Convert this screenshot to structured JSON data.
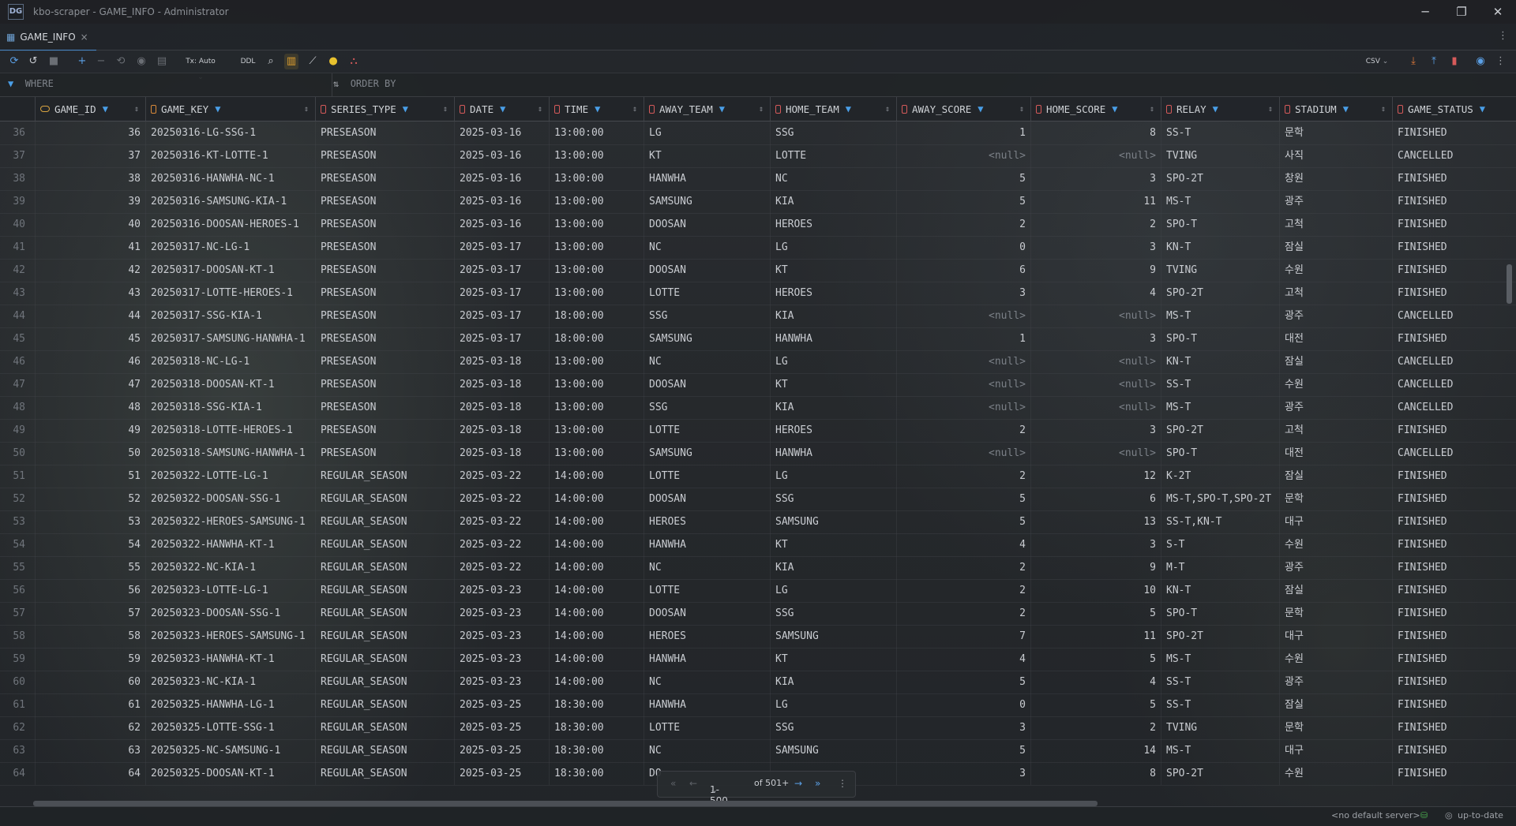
{
  "window": {
    "title": "kbo-scraper - GAME_INFO - Administrator",
    "controls": [
      "─",
      "❐",
      "✕"
    ]
  },
  "tab": {
    "label": "GAME_INFO",
    "close": "×"
  },
  "toolbar": {
    "tx_label": "Tx: Auto",
    "ddl_label": "DDL",
    "export_format": "CSV"
  },
  "filter": {
    "where_label": "WHERE",
    "orderby_label": "ORDER BY"
  },
  "columns": [
    {
      "label": "GAME_ID",
      "icon": "key-icon"
    },
    {
      "label": "GAME_KEY",
      "icon": "index-icon"
    },
    {
      "label": "SERIES_TYPE",
      "icon": "column-icon"
    },
    {
      "label": "DATE",
      "icon": "column-icon"
    },
    {
      "label": "TIME",
      "icon": "column-icon"
    },
    {
      "label": "AWAY_TEAM",
      "icon": "column-icon"
    },
    {
      "label": "HOME_TEAM",
      "icon": "column-icon"
    },
    {
      "label": "AWAY_SCORE",
      "icon": "column-icon"
    },
    {
      "label": "HOME_SCORE",
      "icon": "column-icon"
    },
    {
      "label": "RELAY",
      "icon": "column-icon"
    },
    {
      "label": "STADIUM",
      "icon": "column-icon"
    },
    {
      "label": "GAME_STATUS",
      "icon": "column-icon"
    }
  ],
  "rows": [
    [
      "36",
      "36",
      "20250316-LG-SSG-1",
      "PRESEASON",
      "2025-03-16",
      "13:00:00",
      "LG",
      "SSG",
      "1",
      "8",
      "SS-T",
      "문학",
      "FINISHED"
    ],
    [
      "37",
      "37",
      "20250316-KT-LOTTE-1",
      "PRESEASON",
      "2025-03-16",
      "13:00:00",
      "KT",
      "LOTTE",
      "<null>",
      "<null>",
      "TVING",
      "사직",
      "CANCELLED"
    ],
    [
      "38",
      "38",
      "20250316-HANWHA-NC-1",
      "PRESEASON",
      "2025-03-16",
      "13:00:00",
      "HANWHA",
      "NC",
      "5",
      "3",
      "SPO-2T",
      "창원",
      "FINISHED"
    ],
    [
      "39",
      "39",
      "20250316-SAMSUNG-KIA-1",
      "PRESEASON",
      "2025-03-16",
      "13:00:00",
      "SAMSUNG",
      "KIA",
      "5",
      "11",
      "MS-T",
      "광주",
      "FINISHED"
    ],
    [
      "40",
      "40",
      "20250316-DOOSAN-HEROES-1",
      "PRESEASON",
      "2025-03-16",
      "13:00:00",
      "DOOSAN",
      "HEROES",
      "2",
      "2",
      "SPO-T",
      "고척",
      "FINISHED"
    ],
    [
      "41",
      "41",
      "20250317-NC-LG-1",
      "PRESEASON",
      "2025-03-17",
      "13:00:00",
      "NC",
      "LG",
      "0",
      "3",
      "KN-T",
      "잠실",
      "FINISHED"
    ],
    [
      "42",
      "42",
      "20250317-DOOSAN-KT-1",
      "PRESEASON",
      "2025-03-17",
      "13:00:00",
      "DOOSAN",
      "KT",
      "6",
      "9",
      "TVING",
      "수원",
      "FINISHED"
    ],
    [
      "43",
      "43",
      "20250317-LOTTE-HEROES-1",
      "PRESEASON",
      "2025-03-17",
      "13:00:00",
      "LOTTE",
      "HEROES",
      "3",
      "4",
      "SPO-2T",
      "고척",
      "FINISHED"
    ],
    [
      "44",
      "44",
      "20250317-SSG-KIA-1",
      "PRESEASON",
      "2025-03-17",
      "18:00:00",
      "SSG",
      "KIA",
      "<null>",
      "<null>",
      "MS-T",
      "광주",
      "CANCELLED"
    ],
    [
      "45",
      "45",
      "20250317-SAMSUNG-HANWHA-1",
      "PRESEASON",
      "2025-03-17",
      "18:00:00",
      "SAMSUNG",
      "HANWHA",
      "1",
      "3",
      "SPO-T",
      "대전",
      "FINISHED"
    ],
    [
      "46",
      "46",
      "20250318-NC-LG-1",
      "PRESEASON",
      "2025-03-18",
      "13:00:00",
      "NC",
      "LG",
      "<null>",
      "<null>",
      "KN-T",
      "잠실",
      "CANCELLED"
    ],
    [
      "47",
      "47",
      "20250318-DOOSAN-KT-1",
      "PRESEASON",
      "2025-03-18",
      "13:00:00",
      "DOOSAN",
      "KT",
      "<null>",
      "<null>",
      "SS-T",
      "수원",
      "CANCELLED"
    ],
    [
      "48",
      "48",
      "20250318-SSG-KIA-1",
      "PRESEASON",
      "2025-03-18",
      "13:00:00",
      "SSG",
      "KIA",
      "<null>",
      "<null>",
      "MS-T",
      "광주",
      "CANCELLED"
    ],
    [
      "49",
      "49",
      "20250318-LOTTE-HEROES-1",
      "PRESEASON",
      "2025-03-18",
      "13:00:00",
      "LOTTE",
      "HEROES",
      "2",
      "3",
      "SPO-2T",
      "고척",
      "FINISHED"
    ],
    [
      "50",
      "50",
      "20250318-SAMSUNG-HANWHA-1",
      "PRESEASON",
      "2025-03-18",
      "13:00:00",
      "SAMSUNG",
      "HANWHA",
      "<null>",
      "<null>",
      "SPO-T",
      "대전",
      "CANCELLED"
    ],
    [
      "51",
      "51",
      "20250322-LOTTE-LG-1",
      "REGULAR_SEASON",
      "2025-03-22",
      "14:00:00",
      "LOTTE",
      "LG",
      "2",
      "12",
      "K-2T",
      "잠실",
      "FINISHED"
    ],
    [
      "52",
      "52",
      "20250322-DOOSAN-SSG-1",
      "REGULAR_SEASON",
      "2025-03-22",
      "14:00:00",
      "DOOSAN",
      "SSG",
      "5",
      "6",
      "MS-T,SPO-T,SPO-2T",
      "문학",
      "FINISHED"
    ],
    [
      "53",
      "53",
      "20250322-HEROES-SAMSUNG-1",
      "REGULAR_SEASON",
      "2025-03-22",
      "14:00:00",
      "HEROES",
      "SAMSUNG",
      "5",
      "13",
      "SS-T,KN-T",
      "대구",
      "FINISHED"
    ],
    [
      "54",
      "54",
      "20250322-HANWHA-KT-1",
      "REGULAR_SEASON",
      "2025-03-22",
      "14:00:00",
      "HANWHA",
      "KT",
      "4",
      "3",
      "S-T",
      "수원",
      "FINISHED"
    ],
    [
      "55",
      "55",
      "20250322-NC-KIA-1",
      "REGULAR_SEASON",
      "2025-03-22",
      "14:00:00",
      "NC",
      "KIA",
      "2",
      "9",
      "M-T",
      "광주",
      "FINISHED"
    ],
    [
      "56",
      "56",
      "20250323-LOTTE-LG-1",
      "REGULAR_SEASON",
      "2025-03-23",
      "14:00:00",
      "LOTTE",
      "LG",
      "2",
      "10",
      "KN-T",
      "잠실",
      "FINISHED"
    ],
    [
      "57",
      "57",
      "20250323-DOOSAN-SSG-1",
      "REGULAR_SEASON",
      "2025-03-23",
      "14:00:00",
      "DOOSAN",
      "SSG",
      "2",
      "5",
      "SPO-T",
      "문학",
      "FINISHED"
    ],
    [
      "58",
      "58",
      "20250323-HEROES-SAMSUNG-1",
      "REGULAR_SEASON",
      "2025-03-23",
      "14:00:00",
      "HEROES",
      "SAMSUNG",
      "7",
      "11",
      "SPO-2T",
      "대구",
      "FINISHED"
    ],
    [
      "59",
      "59",
      "20250323-HANWHA-KT-1",
      "REGULAR_SEASON",
      "2025-03-23",
      "14:00:00",
      "HANWHA",
      "KT",
      "4",
      "5",
      "MS-T",
      "수원",
      "FINISHED"
    ],
    [
      "60",
      "60",
      "20250323-NC-KIA-1",
      "REGULAR_SEASON",
      "2025-03-23",
      "14:00:00",
      "NC",
      "KIA",
      "5",
      "4",
      "SS-T",
      "광주",
      "FINISHED"
    ],
    [
      "61",
      "61",
      "20250325-HANWHA-LG-1",
      "REGULAR_SEASON",
      "2025-03-25",
      "18:30:00",
      "HANWHA",
      "LG",
      "0",
      "5",
      "SS-T",
      "잠실",
      "FINISHED"
    ],
    [
      "62",
      "62",
      "20250325-LOTTE-SSG-1",
      "REGULAR_SEASON",
      "2025-03-25",
      "18:30:00",
      "LOTTE",
      "SSG",
      "3",
      "2",
      "TVING",
      "문학",
      "FINISHED"
    ],
    [
      "63",
      "63",
      "20250325-NC-SAMSUNG-1",
      "REGULAR_SEASON",
      "2025-03-25",
      "18:30:00",
      "NC",
      "SAMSUNG",
      "5",
      "14",
      "MS-T",
      "대구",
      "FINISHED"
    ],
    [
      "64",
      "64",
      "20250325-DOOSAN-KT-1",
      "REGULAR_SEASON",
      "2025-03-25",
      "18:30:00",
      "DO",
      "",
      "3",
      "8",
      "SPO-2T",
      "수원",
      "FINISHED"
    ]
  ],
  "pager": {
    "range": "1-500",
    "total": "of 501+"
  },
  "status": {
    "server": "<no default server>",
    "sync": "up-to-date"
  },
  "colors": {
    "accent": "#4a88c7",
    "filter_icon": "#4a9fe8",
    "column_icon": "#d65a5a",
    "key_icon": "#d9a441"
  }
}
